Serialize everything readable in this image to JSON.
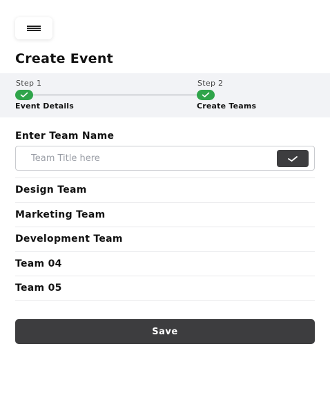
{
  "header": {
    "menu_icon": "hamburger-icon",
    "title": "Create Event"
  },
  "stepper": {
    "steps": [
      {
        "label": "Step 1",
        "name": "Event Details",
        "completed": true,
        "icon": "check-icon"
      },
      {
        "label": "Step 2",
        "name": "Create Teams",
        "completed": true,
        "icon": "check-icon"
      }
    ],
    "accent_color": "#2fa44a"
  },
  "team_form": {
    "label": "Enter Team Name",
    "placeholder": "Team Title here",
    "value": "",
    "confirm_icon": "check-icon"
  },
  "teams": [
    "Design Team",
    "Marketing Team",
    "Development Team",
    "Team 04",
    "Team 05"
  ],
  "actions": {
    "save_label": "Save",
    "button_color": "#3d3d3f"
  }
}
